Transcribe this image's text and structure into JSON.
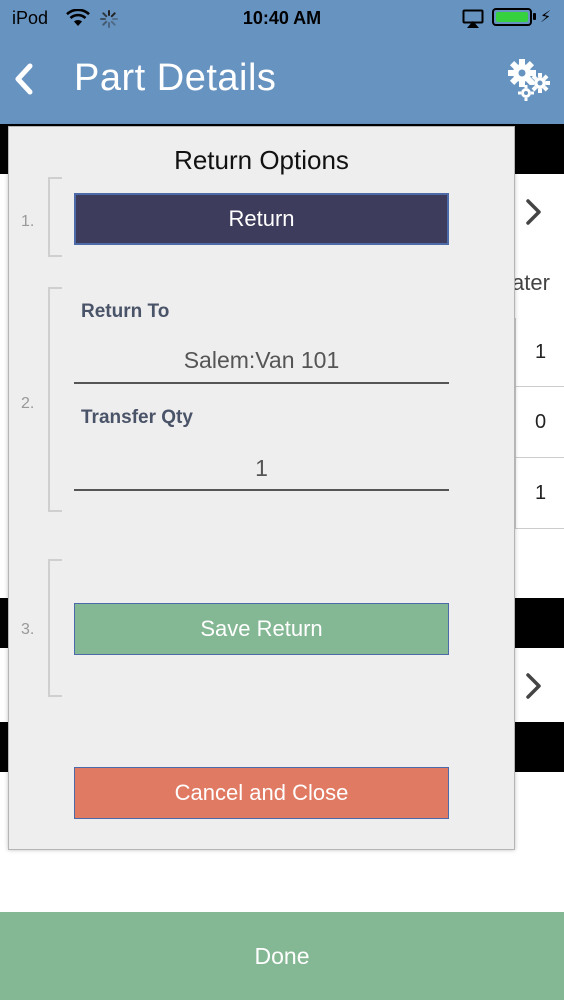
{
  "status_bar": {
    "carrier": "iPod",
    "time": "10:40 AM"
  },
  "nav": {
    "title": "Part Details"
  },
  "background": {
    "header_partial": "ater",
    "values": [
      "1",
      "0",
      "1"
    ]
  },
  "dialog": {
    "title": "Return Options",
    "steps": [
      {
        "number": "1."
      },
      {
        "number": "2."
      },
      {
        "number": "3."
      }
    ],
    "return_button": "Return",
    "return_to": {
      "label": "Return To",
      "value": "Salem:Van 101"
    },
    "transfer_qty": {
      "label": "Transfer Qty",
      "value": "1"
    },
    "save_button": "Save Return",
    "cancel_button": "Cancel and Close"
  },
  "footer": {
    "done_button": "Done"
  },
  "colors": {
    "nav": "#6793c0",
    "return_button": "#3d3c5c",
    "save_button": "#84b793",
    "cancel_button": "#e07a62",
    "done_bar": "#84b793"
  },
  "icons": [
    "wifi-icon",
    "activity-spinner-icon",
    "airplay-icon",
    "battery-icon",
    "back-chevron-icon",
    "gears-icon",
    "chevron-right-icon"
  ]
}
